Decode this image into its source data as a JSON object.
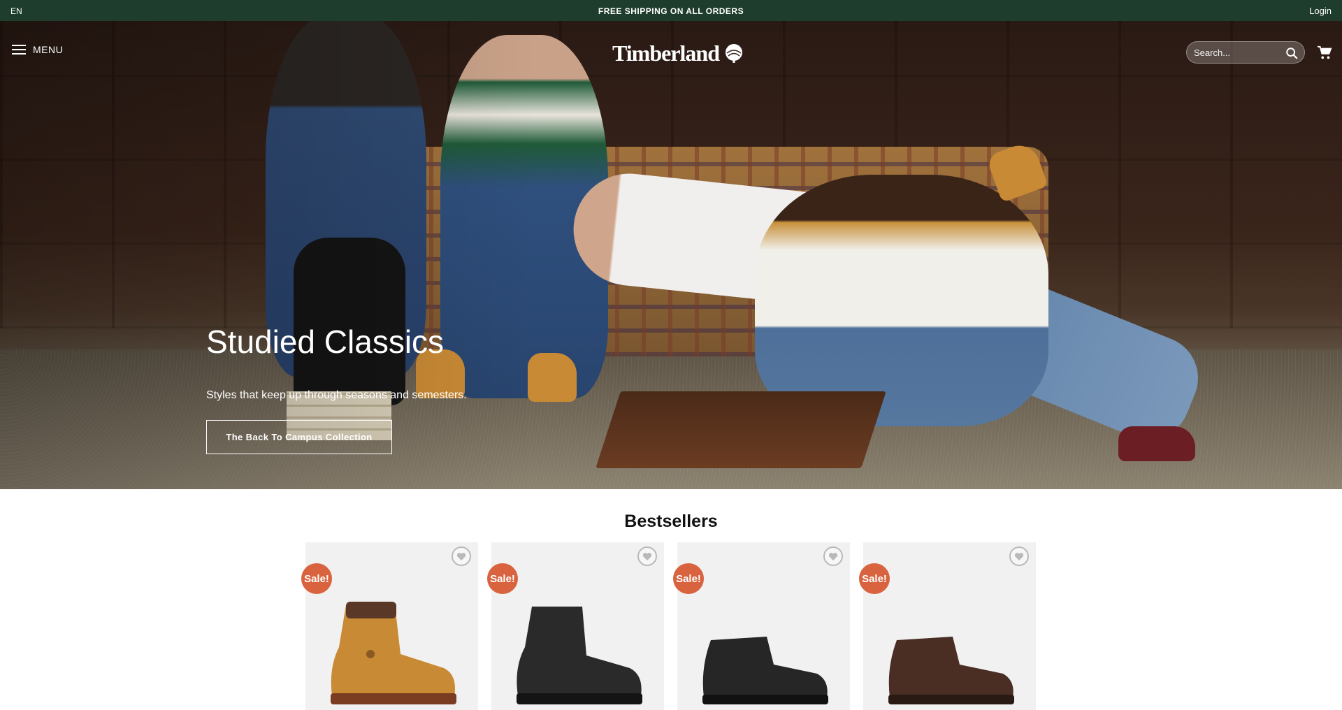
{
  "topbar": {
    "language": "EN",
    "promo": "FREE SHIPPING ON ALL ORDERS",
    "login": "Login"
  },
  "header": {
    "menu_label": "MENU",
    "brand": "Timberland",
    "search_placeholder": "Search..."
  },
  "hero": {
    "title": "Studied Classics",
    "subtitle": "Styles that keep up through seasons and semesters.",
    "cta_label": "The Back To Campus Collection"
  },
  "bestsellers": {
    "title": "Bestsellers",
    "products": [
      {
        "badge": "Sale!",
        "color": "#c88a34",
        "style": "tall-boot"
      },
      {
        "badge": "Sale!",
        "color": "#2a2a2a",
        "style": "tall-boot"
      },
      {
        "badge": "Sale!",
        "color": "#262626",
        "style": "chukka"
      },
      {
        "badge": "Sale!",
        "color": "#4a2e24",
        "style": "chukka"
      }
    ]
  },
  "colors": {
    "topbar_bg": "#1f3d2c",
    "sale_badge": "#d9633e"
  }
}
